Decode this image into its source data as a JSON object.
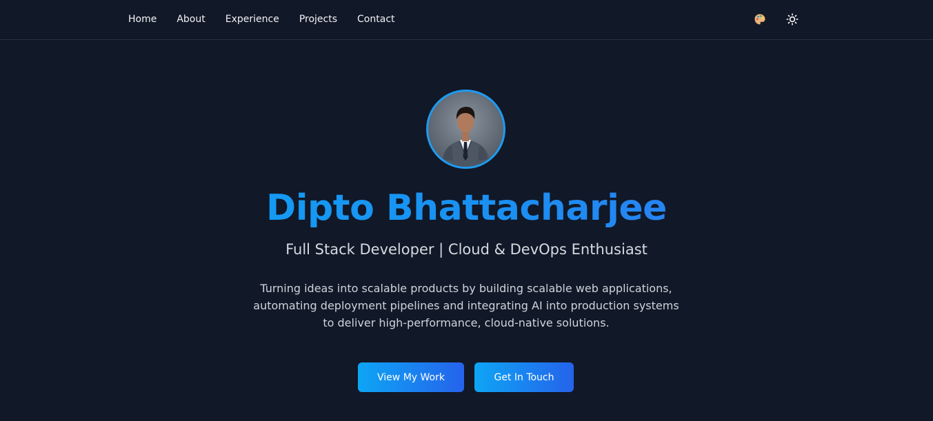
{
  "nav": {
    "links": [
      "Home",
      "About",
      "Experience",
      "Projects",
      "Contact"
    ],
    "icons": [
      "palette-icon",
      "sun-icon"
    ]
  },
  "hero": {
    "name": "Dipto Bhattacharjee",
    "subtitle": "Full Stack Developer | Cloud & DevOps Enthusiast",
    "description": "Turning ideas into scalable products by building scalable web applications, automating deployment pipelines and integrating AI into production systems to deliver high-performance, cloud-native solutions.",
    "buttons": {
      "primary": "View My Work",
      "secondary": "Get In Touch"
    }
  },
  "colors": {
    "background": "#111827",
    "accent_start": "#0ea5f5",
    "accent_end": "#2563eb",
    "avatar_border": "#1e9bf0"
  }
}
